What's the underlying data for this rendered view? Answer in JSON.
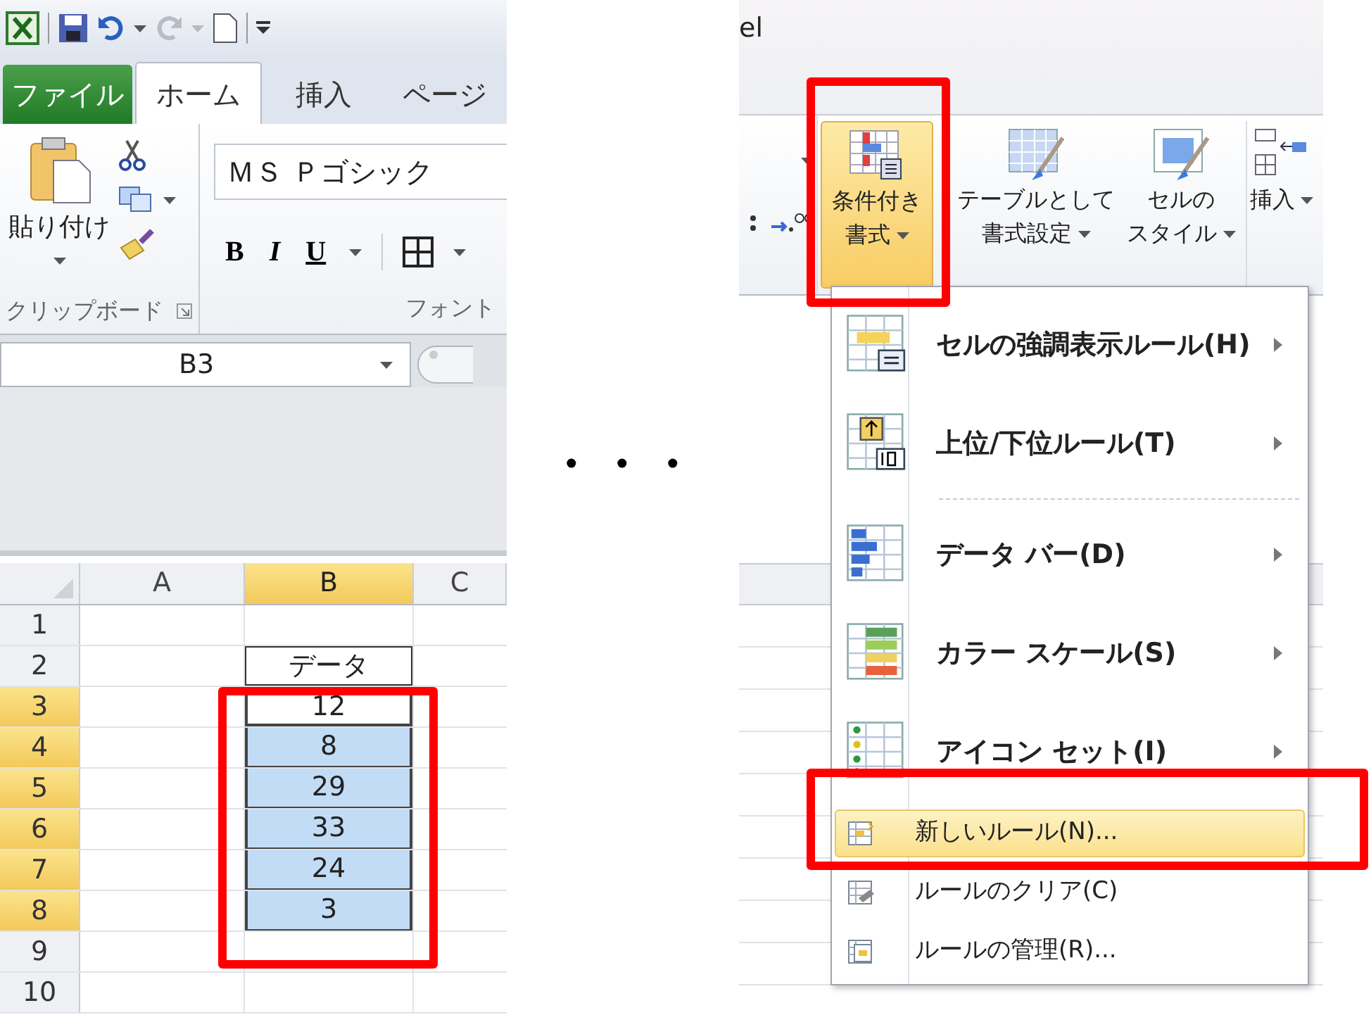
{
  "left": {
    "tabs": [
      {
        "label": "ファイル",
        "kind": "file",
        "selected": false
      },
      {
        "label": "ホーム",
        "kind": "tab",
        "selected": true
      },
      {
        "label": "挿入",
        "kind": "tab",
        "selected": false
      },
      {
        "label": "ページ",
        "kind": "tab",
        "selected": false
      }
    ],
    "clipboard": {
      "paste_label": "貼り付け",
      "group_label": "クリップボード"
    },
    "font": {
      "font_name": "ＭＳ Ｐゴシック",
      "bold": "B",
      "italic": "I",
      "underline": "U",
      "group_label": "フォント"
    },
    "name_box": "B3",
    "columns": [
      {
        "label": "A",
        "selected": false
      },
      {
        "label": "B",
        "selected": true
      },
      {
        "label": "C",
        "selected": false
      }
    ],
    "rows": [
      {
        "number": "1",
        "selected": false,
        "kind": "plain"
      },
      {
        "number": "2",
        "selected": false,
        "kind": "heading",
        "value": "データ"
      },
      {
        "number": "3",
        "selected": true,
        "kind": "active",
        "value": "12"
      },
      {
        "number": "4",
        "selected": true,
        "kind": "selected",
        "value": "8"
      },
      {
        "number": "5",
        "selected": true,
        "kind": "selected",
        "value": "29"
      },
      {
        "number": "6",
        "selected": true,
        "kind": "selected",
        "value": "33"
      },
      {
        "number": "7",
        "selected": true,
        "kind": "selected",
        "value": "24"
      },
      {
        "number": "8",
        "selected": true,
        "kind": "selected",
        "value": "3"
      },
      {
        "number": "9",
        "selected": false,
        "kind": "plain"
      },
      {
        "number": "10",
        "selected": false,
        "kind": "plain"
      }
    ]
  },
  "separator": "・・・",
  "right": {
    "title_fragment": "el",
    "ribbon_buttons": [
      {
        "lines": [
          "条件付き",
          "書式"
        ],
        "kind": "conditional",
        "selected": true
      },
      {
        "lines": [
          "テーブルとして",
          "書式設定"
        ],
        "kind": "table",
        "selected": false
      },
      {
        "lines": [
          "セルの",
          "スタイル"
        ],
        "kind": "style",
        "selected": false
      },
      {
        "lines": [
          "挿入"
        ],
        "kind": "insert",
        "selected": false
      }
    ],
    "menu": [
      {
        "kind": "large",
        "label": "セルの強調表示ルール(H)",
        "selected": false
      },
      {
        "kind": "large",
        "label": "上位/下位ルール(T)",
        "selected": false
      },
      {
        "kind": "separator"
      },
      {
        "kind": "large",
        "label": "データ バー(D)",
        "selected": false
      },
      {
        "kind": "large",
        "label": "カラー スケール(S)",
        "selected": false
      },
      {
        "kind": "large",
        "label": "アイコン セット(I)",
        "selected": false
      },
      {
        "kind": "small",
        "label": "新しいルール(N)...",
        "selected": true
      },
      {
        "kind": "small",
        "label": "ルールのクリア(C)",
        "selected": false
      },
      {
        "kind": "small",
        "label": "ルールの管理(R)...",
        "selected": false
      }
    ]
  }
}
